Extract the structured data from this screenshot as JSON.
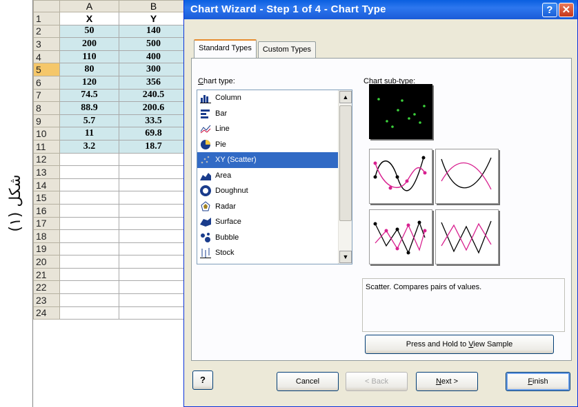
{
  "caption": "شكل (١)",
  "sheet": {
    "columns": [
      "A",
      "B"
    ],
    "rows": [
      {
        "n": "1",
        "a": "X",
        "b": "Y",
        "header": true
      },
      {
        "n": "2",
        "a": "50",
        "b": "140"
      },
      {
        "n": "3",
        "a": "200",
        "b": "500"
      },
      {
        "n": "4",
        "a": "110",
        "b": "400"
      },
      {
        "n": "5",
        "a": "80",
        "b": "300"
      },
      {
        "n": "6",
        "a": "120",
        "b": "356"
      },
      {
        "n": "7",
        "a": "74.5",
        "b": "240.5"
      },
      {
        "n": "8",
        "a": "88.9",
        "b": "200.6"
      },
      {
        "n": "9",
        "a": "5.7",
        "b": "33.5"
      },
      {
        "n": "10",
        "a": "11",
        "b": "69.8"
      },
      {
        "n": "11",
        "a": "3.2",
        "b": "18.7"
      },
      {
        "n": "12",
        "a": "",
        "b": ""
      },
      {
        "n": "13",
        "a": "",
        "b": ""
      },
      {
        "n": "14",
        "a": "",
        "b": ""
      },
      {
        "n": "15",
        "a": "",
        "b": ""
      },
      {
        "n": "16",
        "a": "",
        "b": ""
      },
      {
        "n": "17",
        "a": "",
        "b": ""
      },
      {
        "n": "18",
        "a": "",
        "b": ""
      },
      {
        "n": "19",
        "a": "",
        "b": ""
      },
      {
        "n": "20",
        "a": "",
        "b": ""
      },
      {
        "n": "21",
        "a": "",
        "b": ""
      },
      {
        "n": "22",
        "a": "",
        "b": ""
      },
      {
        "n": "23",
        "a": "",
        "b": ""
      },
      {
        "n": "24",
        "a": "",
        "b": ""
      }
    ],
    "selected_row": "5"
  },
  "dialog": {
    "title": "Chart Wizard - Step 1 of 4 - Chart Type",
    "help_glyph": "?",
    "close_glyph": "✕",
    "tabs": [
      "Standard Types",
      "Custom Types"
    ],
    "active_tab": 0,
    "chart_type_label_pre": "",
    "chart_type_label_u": "C",
    "chart_type_label_post": "hart type:",
    "subtype_label_pre": "Chart sub-",
    "subtype_label_u": "t",
    "subtype_label_post": "ype:",
    "chart_types": [
      {
        "label": "Column",
        "icon": "column-chart-icon"
      },
      {
        "label": "Bar",
        "icon": "bar-chart-icon"
      },
      {
        "label": "Line",
        "icon": "line-chart-icon"
      },
      {
        "label": "Pie",
        "icon": "pie-chart-icon"
      },
      {
        "label": "XY (Scatter)",
        "icon": "scatter-chart-icon",
        "selected": true
      },
      {
        "label": "Area",
        "icon": "area-chart-icon"
      },
      {
        "label": "Doughnut",
        "icon": "doughnut-chart-icon"
      },
      {
        "label": "Radar",
        "icon": "radar-chart-icon"
      },
      {
        "label": "Surface",
        "icon": "surface-chart-icon"
      },
      {
        "label": "Bubble",
        "icon": "bubble-chart-icon"
      },
      {
        "label": "Stock",
        "icon": "stock-chart-icon"
      }
    ],
    "description": "Scatter. Compares pairs of values.",
    "sample_button_pre": "Press and Hold to ",
    "sample_button_u": "V",
    "sample_button_post": "iew Sample",
    "cancel": "Cancel",
    "back": "< Back",
    "next_u": "N",
    "next_post": "ext >",
    "finish_u": "F",
    "finish_post": "inish",
    "help_button_glyph": "?",
    "colors": {
      "title_bar": "#1a5bd8",
      "selection": "#316ac5",
      "highlight_cells": "#cfe8ec",
      "markers": "#d8208f"
    }
  }
}
